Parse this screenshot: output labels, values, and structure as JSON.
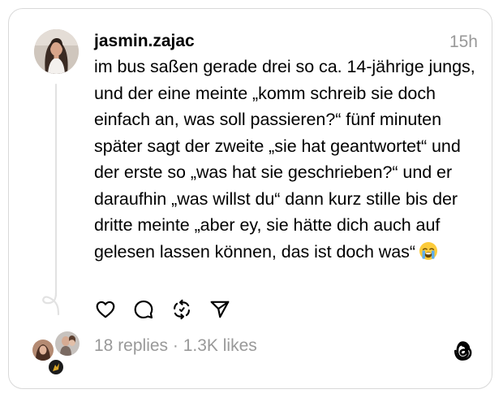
{
  "post": {
    "username": "jasmin.zajac",
    "time": "15h",
    "text": "im bus saßen gerade drei so ca. 14-jährige jungs, und der eine meinte „komm schreib sie doch einfach an, was soll passieren?“ fünf minuten später sagt der zweite „sie hat geantwortet“ und der erste so „was hat sie geschrieben?“ und er daraufhin „was willst du“ dann kurz stille bis der dritte meinte „aber ey, sie hätte dich auch auf gelesen lassen können, das ist doch was“",
    "emoji": "loudly-crying-face"
  },
  "actions": {
    "like_icon": "heart-icon",
    "reply_icon": "comment-icon",
    "repost_icon": "repost-icon",
    "share_icon": "send-icon"
  },
  "stats": {
    "replies": "18 replies",
    "separator": " · ",
    "likes": "1.3K likes"
  },
  "colors": {
    "text": "#000000",
    "muted": "#999999",
    "border": "#d9d9d9",
    "thread_line": "#e2e2e2"
  }
}
